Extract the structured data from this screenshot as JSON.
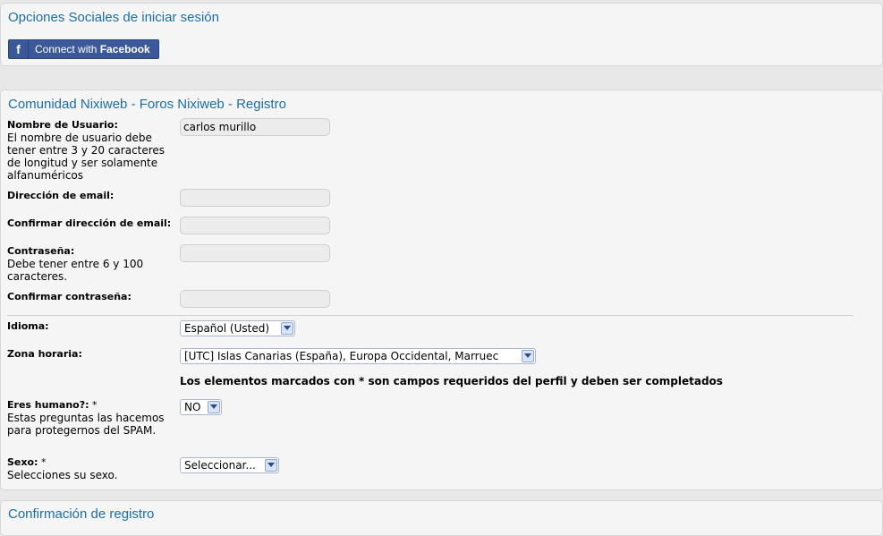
{
  "social": {
    "title": "Opciones Sociales de iniciar sesión",
    "fb_icon": "f",
    "fb_connect": "Connect with",
    "fb_brand": "Facebook"
  },
  "register": {
    "title": "Comunidad Nixiweb - Foros Nixiweb - Registro",
    "username": {
      "label": "Nombre de Usuario:",
      "desc": "El nombre de usuario debe tener entre 3 y 20 caracteres de longitud y ser solamente alfanuméricos",
      "value": "carlos murillo"
    },
    "email": {
      "label": "Dirección de email:",
      "value": ""
    },
    "email_confirm": {
      "label": "Confirmar dirección de email:",
      "value": ""
    },
    "password": {
      "label": "Contraseña:",
      "desc": "Debe tener entre 6 y 100 caracteres.",
      "value": ""
    },
    "password_confirm": {
      "label": "Confirmar contraseña:",
      "value": ""
    },
    "language": {
      "label": "Idioma:",
      "selected": "Español (Usted)"
    },
    "timezone": {
      "label": "Zona horaria:",
      "selected": "[UTC] Islas Canarias (España), Europa Occidental, Marruec"
    },
    "required_note": "Los elementos marcados con * son campos requeridos del perfil y deben ser completados",
    "human": {
      "label": "Eres humano?:",
      "required_mark": "*",
      "desc": "Estas preguntas las hacemos para protegernos del SPAM.",
      "selected": "NO"
    },
    "gender": {
      "label": "Sexo:",
      "required_mark": "*",
      "desc": "Selecciones su sexo.",
      "selected": "Seleccionar..."
    }
  },
  "confirm": {
    "title": "Confirmación de registro"
  },
  "colors": {
    "title_blue": "#1c6ea5",
    "facebook_blue": "#3b5998"
  }
}
